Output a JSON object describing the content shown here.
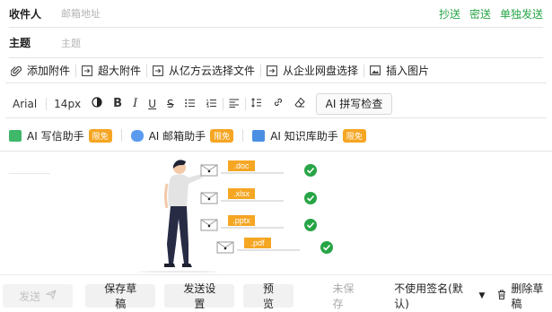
{
  "header": {
    "to_label": "收件人",
    "to_placeholder": "邮箱地址",
    "cc": "抄送",
    "bcc": "密送",
    "separate": "单独发送",
    "subject_label": "主题",
    "subject_placeholder": "主题"
  },
  "attachments": {
    "add": "添加附件",
    "large": "超大附件",
    "cloud": "从亿方云选择文件",
    "netdisk": "从企业网盘选择",
    "image": "插入图片"
  },
  "toolbar": {
    "font": "Arial",
    "size": "14px",
    "bold": "B",
    "italic": "I",
    "underline": "U",
    "strike": "S",
    "spellcheck": "AI 拼写检查"
  },
  "ai": {
    "writer": "AI 写信助手",
    "mailbox": "AI 邮箱助手",
    "kb": "AI 知识库助手",
    "free": "限免"
  },
  "files": [
    ".doc",
    ".xlsx",
    ".pptx",
    ".pdf"
  ],
  "colors": {
    "accent": "#27a546",
    "tag": "#f5a623",
    "badge": "#f5a623"
  },
  "footer": {
    "send": "发送",
    "save_draft": "保存草稿",
    "send_settings": "发送设置",
    "preview": "预览",
    "unsaved": "未保存",
    "signature": "不使用签名(默认)",
    "delete_draft": "删除草稿"
  }
}
